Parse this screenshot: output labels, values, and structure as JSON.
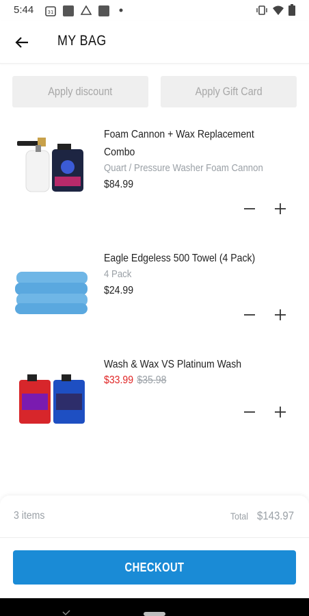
{
  "status_bar": {
    "time": "5:44",
    "icons_left": [
      "calendar-icon",
      "square-icon",
      "drive-icon",
      "square-icon",
      "dot-icon"
    ],
    "icons_right": [
      "vibrate-icon",
      "wifi-icon",
      "battery-icon"
    ]
  },
  "header": {
    "title": "MY BAG",
    "back_icon": "arrow-left-icon"
  },
  "actions": {
    "discount_label": "Apply discount",
    "gift_card_label": "Apply Gift Card"
  },
  "items": [
    {
      "name": "Foam Cannon + Wax Replacement Combo",
      "variant": "Quart / Pressure Washer Foam Cannon",
      "price": "$84.99"
    },
    {
      "name": "Eagle Edgeless 500 Towel (4 Pack)",
      "variant": "4 Pack",
      "price": "$24.99"
    },
    {
      "name": "Wash & Wax VS Platinum Wash",
      "sale_price": "$33.99",
      "original_price": "$35.98"
    }
  ],
  "footer": {
    "items_count": "3 items",
    "total_label": "Total",
    "total_value": "$143.97",
    "checkout_label": "CHECKOUT"
  },
  "colors": {
    "accent": "#1a8bd6",
    "sale": "#e02424",
    "muted": "#9aa0a6",
    "button_bg": "#efefef"
  }
}
